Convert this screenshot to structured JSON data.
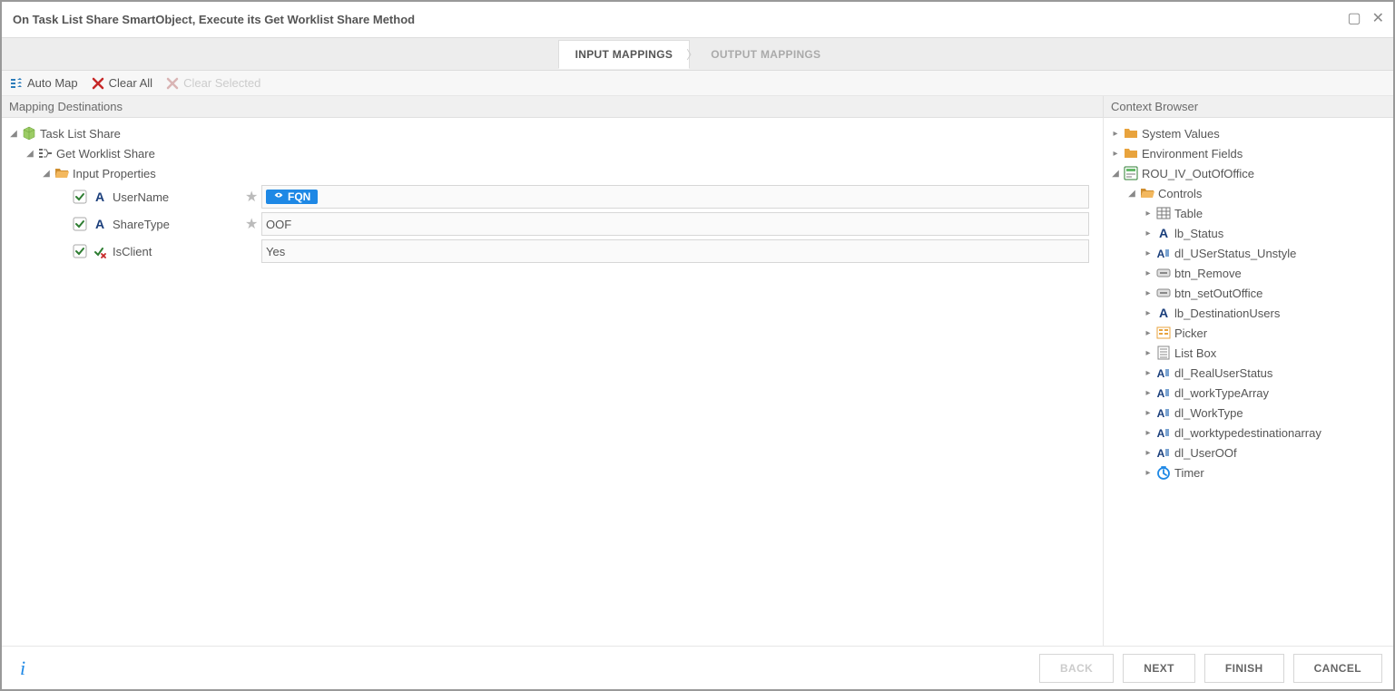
{
  "header": {
    "title": "On Task List Share SmartObject, Execute its Get Worklist Share Method"
  },
  "tabs": {
    "input": "INPUT MAPPINGS",
    "output": "OUTPUT MAPPINGS"
  },
  "toolbar": {
    "autoMap": "Auto Map",
    "clearAll": "Clear All",
    "clearSelected": "Clear Selected"
  },
  "panels": {
    "left": "Mapping Destinations",
    "right": "Context Browser"
  },
  "mapping": {
    "root": "Task List Share",
    "method": "Get Worklist Share",
    "group": "Input Properties",
    "props": [
      {
        "name": "UserName",
        "required": true,
        "token": "FQN",
        "type": "text"
      },
      {
        "name": "ShareType",
        "required": true,
        "value": "OOF",
        "type": "text"
      },
      {
        "name": "IsClient",
        "required": false,
        "value": "Yes",
        "type": "bool"
      }
    ]
  },
  "context": {
    "top": [
      {
        "label": "System Values"
      },
      {
        "label": "Environment Fields"
      }
    ],
    "form": "ROU_IV_OutOfOffice",
    "controlsGroup": "Controls",
    "controls": [
      {
        "label": "Table",
        "icon": "table"
      },
      {
        "label": "lb_Status",
        "icon": "A"
      },
      {
        "label": "dl_USerStatus_Unstyle",
        "icon": "datalabel"
      },
      {
        "label": "btn_Remove",
        "icon": "button"
      },
      {
        "label": "btn_setOutOffice",
        "icon": "button"
      },
      {
        "label": "lb_DestinationUsers",
        "icon": "A"
      },
      {
        "label": "Picker",
        "icon": "picker"
      },
      {
        "label": "List Box",
        "icon": "listbox"
      },
      {
        "label": "dl_RealUserStatus",
        "icon": "datalabel"
      },
      {
        "label": "dl_workTypeArray",
        "icon": "datalabel"
      },
      {
        "label": "dl_WorkType",
        "icon": "datalabel"
      },
      {
        "label": "dl_worktypedestinationarray",
        "icon": "datalabel"
      },
      {
        "label": "dl_UserOOf",
        "icon": "datalabel"
      },
      {
        "label": "Timer",
        "icon": "timer"
      }
    ]
  },
  "footer": {
    "back": "BACK",
    "next": "NEXT",
    "finish": "FINISH",
    "cancel": "CANCEL"
  }
}
